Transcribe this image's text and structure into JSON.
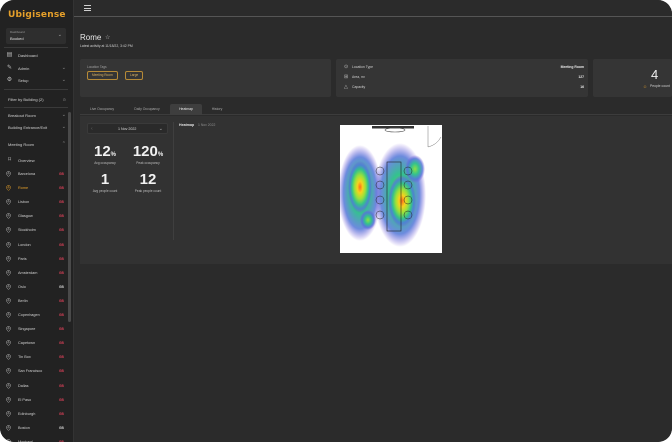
{
  "app": {
    "logo_text": "Ubigisense"
  },
  "dashboard_selector": {
    "label": "Dashboard",
    "value": "Booked",
    "chevron_icon": "chevron-down-icon"
  },
  "sidebar": {
    "menu": [
      {
        "label": "Dashboard",
        "icon": "dashboard-icon",
        "chevron": ""
      },
      {
        "label": "Admin",
        "icon": "wrench-icon",
        "chevron": "⌄"
      },
      {
        "label": "Setup",
        "icon": "gear-icon",
        "chevron": "⌄"
      }
    ],
    "filter_label": "Filter by Building (2)",
    "sections": [
      {
        "label": "Breakout Room",
        "chevron": "⌄"
      },
      {
        "label": "Building Entrance/Exit",
        "chevron": "⌄"
      },
      {
        "label": "Meeting Room",
        "chevron": "⌃"
      }
    ],
    "overview_label": "Overview",
    "sites": [
      {
        "label": "Barcelona",
        "badge": "GB",
        "badge_color": "#e0425a",
        "active": false
      },
      {
        "label": "Rome",
        "badge": "GB",
        "badge_color": "#e0425a",
        "active": true
      },
      {
        "label": "Lisbon",
        "badge": "GB",
        "badge_color": "#e0425a",
        "active": false
      },
      {
        "label": "Glasgow",
        "badge": "GB",
        "badge_color": "#e0425a",
        "active": false
      },
      {
        "label": "Stockholm",
        "badge": "GB",
        "badge_color": "#e0425a",
        "active": false
      },
      {
        "label": "London",
        "badge": "GB",
        "badge_color": "#e0425a",
        "active": false
      },
      {
        "label": "Paris",
        "badge": "GB",
        "badge_color": "#e0425a",
        "active": false
      },
      {
        "label": "Amsterdam",
        "badge": "GB",
        "badge_color": "#e0425a",
        "active": false
      },
      {
        "label": "Oslo",
        "badge": "GB",
        "badge_color": "#d9d9d9",
        "active": false
      },
      {
        "label": "Berlin",
        "badge": "GB",
        "badge_color": "#e0425a",
        "active": false
      },
      {
        "label": "Copenhagen",
        "badge": "GB",
        "badge_color": "#e0425a",
        "active": false
      },
      {
        "label": "Singapore",
        "badge": "GB",
        "badge_color": "#e0425a",
        "active": false
      },
      {
        "label": "Capetown",
        "badge": "GB",
        "badge_color": "#e0425a",
        "active": false
      },
      {
        "label": "Tin Box",
        "badge": "GB",
        "badge_color": "#e0425a",
        "active": false
      },
      {
        "label": "San Francisco",
        "badge": "GB",
        "badge_color": "#e0425a",
        "active": false
      },
      {
        "label": "Dallas",
        "badge": "GB",
        "badge_color": "#e0425a",
        "active": false
      },
      {
        "label": "El Paso",
        "badge": "GB",
        "badge_color": "#e0425a",
        "active": false
      },
      {
        "label": "Edinburgh",
        "badge": "GB",
        "badge_color": "#e0425a",
        "active": false
      },
      {
        "label": "Boston",
        "badge": "GB",
        "badge_color": "#d9d9d9",
        "active": false
      },
      {
        "label": "Montreal",
        "badge": "GB",
        "badge_color": "#e0425a",
        "active": false
      }
    ]
  },
  "header": {
    "menu_icon": "hamburger-icon"
  },
  "room": {
    "title": "Rome",
    "activity": "Latest activity at 11/18/22, 3:42 PM"
  },
  "location_tags": {
    "label": "Location Tags",
    "tags": [
      "Meeting Room",
      "Large"
    ]
  },
  "properties": [
    {
      "icon": "location-type-icon",
      "key": "Location Type",
      "value": "Meeting Room"
    },
    {
      "icon": "area-icon",
      "key": "Area, m²",
      "value": "127"
    },
    {
      "icon": "capacity-icon",
      "key": "Capacity",
      "value": "16"
    }
  ],
  "people": {
    "count": "4",
    "label": "People count"
  },
  "tabs": [
    {
      "label": "Live Occupancy",
      "active": false
    },
    {
      "label": "Daily Occupancy",
      "active": false
    },
    {
      "label": "Heatmap",
      "active": true
    },
    {
      "label": "History",
      "active": false
    }
  ],
  "date_select": {
    "value": "1 Nov 2022"
  },
  "stats": [
    {
      "value": "12",
      "unit": "%",
      "caption": "Avg occupancy"
    },
    {
      "value": "120",
      "unit": "%",
      "caption": "Peak occupancy"
    },
    {
      "value": "1",
      "unit": "",
      "caption": "Avg people count"
    },
    {
      "value": "12",
      "unit": "",
      "caption": "Peak people count"
    }
  ],
  "heatmap": {
    "title": "Heatmap",
    "date": "1 Nov 2022"
  },
  "colors": {
    "accent": "#e6a02a",
    "badge_red": "#e0425a",
    "background": "#2b2b2b",
    "card": "#353535"
  }
}
